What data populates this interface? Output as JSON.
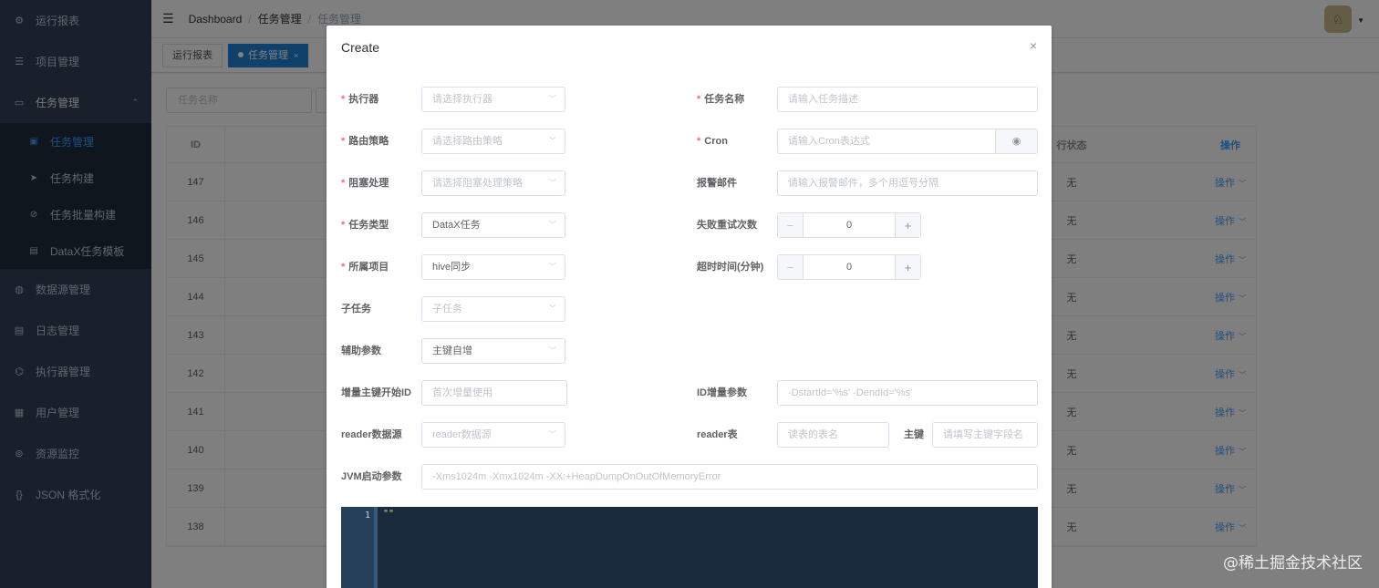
{
  "sidebar": {
    "items": [
      {
        "label": "运行报表",
        "icon": "dashboard-icon"
      },
      {
        "label": "项目管理",
        "icon": "project-icon"
      },
      {
        "label": "任务管理",
        "icon": "monitor-icon"
      },
      {
        "label": "数据源管理",
        "icon": "database-icon"
      },
      {
        "label": "日志管理",
        "icon": "log-icon"
      },
      {
        "label": "执行器管理",
        "icon": "executor-icon"
      },
      {
        "label": "用户管理",
        "icon": "user-icon"
      },
      {
        "label": "资源监控",
        "icon": "monitor-resource-icon"
      },
      {
        "label": "JSON 格式化",
        "icon": "json-icon"
      }
    ],
    "task_sub": [
      {
        "label": "任务管理",
        "icon": "task-doc-icon"
      },
      {
        "label": "任务构建",
        "icon": "send-icon"
      },
      {
        "label": "任务批量构建",
        "icon": "batch-icon"
      },
      {
        "label": "DataX任务模板",
        "icon": "template-icon"
      }
    ]
  },
  "navbar": {
    "breadcrumb": [
      "Dashboard",
      "任务管理",
      "任务管理"
    ]
  },
  "tags": [
    {
      "label": "运行报表"
    },
    {
      "label": "任务管理",
      "close": "×"
    }
  ],
  "filter": {
    "task_name_placeholder": "任务名称"
  },
  "table": {
    "headers": {
      "id": "ID",
      "status": "行状态",
      "op": "操作"
    },
    "rows": [
      {
        "id": "147",
        "status": "无",
        "op": "操作"
      },
      {
        "id": "146",
        "status": "无",
        "op": "操作"
      },
      {
        "id": "145",
        "status": "无",
        "op": "操作"
      },
      {
        "id": "144",
        "status": "无",
        "op": "操作"
      },
      {
        "id": "143",
        "status": "无",
        "op": "操作"
      },
      {
        "id": "142",
        "status": "无",
        "op": "操作"
      },
      {
        "id": "141",
        "status": "无",
        "op": "操作"
      },
      {
        "id": "140",
        "status": "无",
        "op": "操作"
      },
      {
        "id": "139",
        "status": "无",
        "op": "操作"
      },
      {
        "id": "138",
        "status": "无",
        "op": "操作"
      }
    ]
  },
  "dialog": {
    "title": "Create",
    "close": "×",
    "executor": {
      "label": "执行器",
      "placeholder": "请选择执行器"
    },
    "task_name": {
      "label": "任务名称",
      "placeholder": "请输入任务描述"
    },
    "route": {
      "label": "路由策略",
      "placeholder": "请选择路由策略"
    },
    "cron": {
      "label": "Cron",
      "placeholder": "请输入Cron表达式"
    },
    "block": {
      "label": "阻塞处理",
      "placeholder": "请选择阻塞处理策略"
    },
    "alarm_email": {
      "label": "报警邮件",
      "placeholder": "请输入报警邮件，多个用逗号分隔"
    },
    "task_type": {
      "label": "任务类型",
      "value": "DataX任务"
    },
    "retry": {
      "label": "失败重试次数",
      "value": "0",
      "minus": "−",
      "plus": "+"
    },
    "project": {
      "label": "所属项目",
      "value": "hive同步"
    },
    "timeout": {
      "label": "超时时间(分钟)",
      "value": "0",
      "minus": "−",
      "plus": "+"
    },
    "subtask": {
      "label": "子任务",
      "placeholder": "子任务"
    },
    "aux_param": {
      "label": "辅助参数",
      "value": "主键自增"
    },
    "inc_start_id": {
      "label": "增量主键开始ID",
      "placeholder": "首次增量使用"
    },
    "id_inc_param": {
      "label": "ID增量参数",
      "placeholder": "-DstartId='%s' -DendId='%s'"
    },
    "reader_ds": {
      "label": "reader数据源",
      "placeholder": "reader数据源"
    },
    "reader_table": {
      "label": "reader表",
      "placeholder": "读表的表名"
    },
    "primary_key": {
      "label": "主键",
      "placeholder": "请填写主键字段名"
    },
    "jvm": {
      "label": "JVM启动参数",
      "placeholder": "-Xms1024m -Xmx1024m -XX:+HeapDumpOnOutOfMemoryError"
    },
    "editor": {
      "line": "1",
      "code": "\"\""
    }
  },
  "watermark": "@稀土掘金技术社区"
}
